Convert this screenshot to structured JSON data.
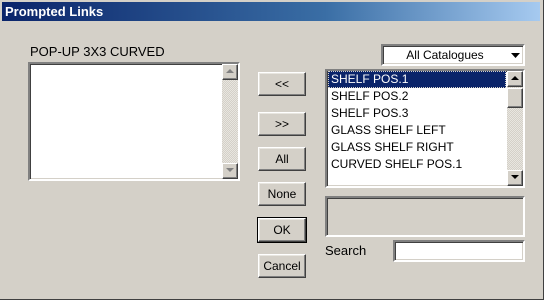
{
  "window": {
    "title": "Prompted Links"
  },
  "left_panel": {
    "heading": "POP-UP 3X3 CURVED",
    "items": []
  },
  "catalogue_select": {
    "value": "All Catalogues"
  },
  "transfer_buttons": {
    "move_left": "<<",
    "move_right": ">>",
    "all": "All",
    "none": "None"
  },
  "dialog_buttons": {
    "ok": "OK",
    "cancel": "Cancel"
  },
  "right_list": {
    "items": [
      {
        "label": "SHELF POS.1",
        "selected": true
      },
      {
        "label": "SHELF POS.2",
        "selected": false
      },
      {
        "label": "SHELF POS.3",
        "selected": false
      },
      {
        "label": "GLASS SHELF LEFT",
        "selected": false
      },
      {
        "label": "GLASS SHELF RIGHT",
        "selected": false
      },
      {
        "label": "CURVED SHELF POS.1",
        "selected": false
      }
    ]
  },
  "info_box": {
    "text": ""
  },
  "search": {
    "label": "Search",
    "value": ""
  },
  "colors": {
    "dialog_bg": "#d4d0c8",
    "title_bar": "#0a246a",
    "selection": "#0a246a",
    "selection_text": "#ffffff"
  }
}
